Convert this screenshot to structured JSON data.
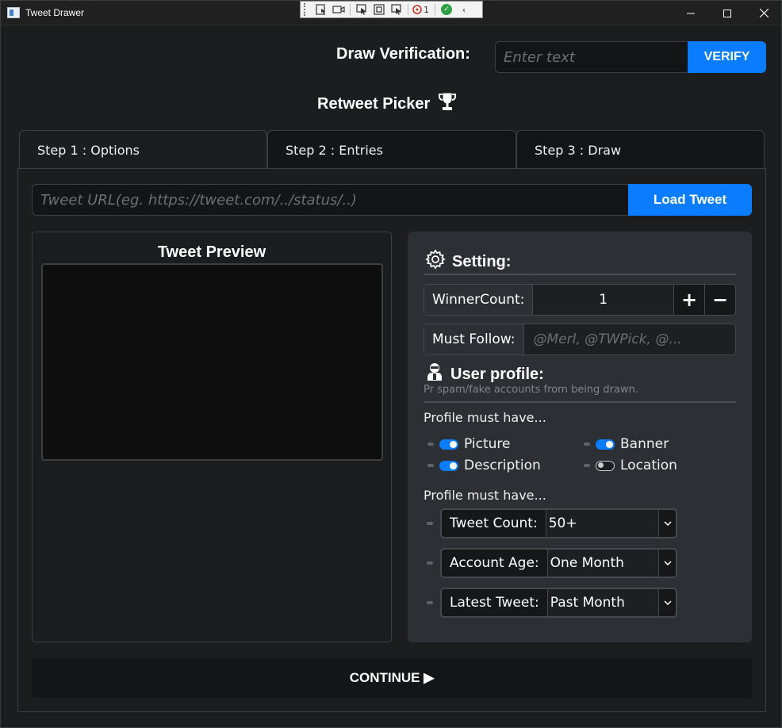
{
  "window": {
    "title": "Tweet Drawer",
    "debug_count": "1"
  },
  "verification": {
    "label": "Draw Verification:",
    "placeholder": "Enter text",
    "button": "VERIFY"
  },
  "heading": "Retweet Picker",
  "tabs": [
    {
      "label": "Step 1 : Options"
    },
    {
      "label": "Step 2 : Entries"
    },
    {
      "label": "Step 3 : Draw"
    }
  ],
  "tweet_url": {
    "placeholder": "Tweet URL(eg. https://tweet.com/../status/..)",
    "button": "Load Tweet"
  },
  "preview": {
    "title": "Tweet Preview"
  },
  "settings": {
    "title": "Setting:",
    "winner_count": {
      "label": "WinnerCount:",
      "value": "1",
      "plus": "+",
      "minus": "−"
    },
    "must_follow": {
      "label": "Must Follow:",
      "placeholder": "@Merl, @TWPick, @..."
    },
    "user_profile": {
      "title": "User profile:",
      "subtitle": "Pr spam/fake accounts from being drawn.",
      "toggles_header": "Profile must have...",
      "toggles": [
        {
          "label": "Picture",
          "on": true
        },
        {
          "label": "Banner",
          "on": true
        },
        {
          "label": "Description",
          "on": true
        },
        {
          "label": "Location",
          "on": false
        }
      ],
      "selects_header": "Profile must have...",
      "selects": [
        {
          "label": "Tweet Count:",
          "value": "50+"
        },
        {
          "label": "Account Age:",
          "value": "One Month"
        },
        {
          "label": "Latest Tweet:",
          "value": "Past Month"
        }
      ]
    }
  },
  "continue_button": "CONTINUE ▶",
  "colors": {
    "accent": "#0a7cff",
    "background": "#1b1d1e",
    "settings_panel": "#2c3034"
  }
}
